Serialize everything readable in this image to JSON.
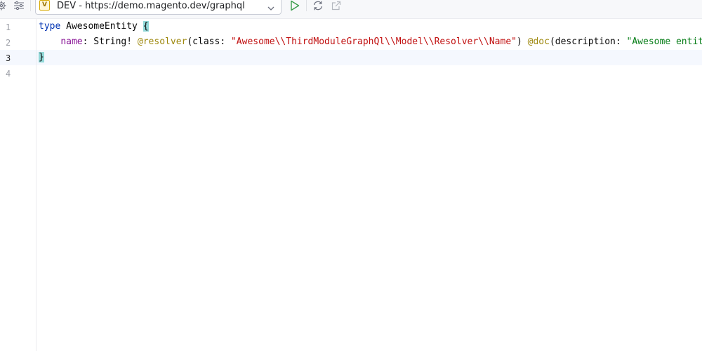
{
  "toolbar": {
    "icons": [
      "settings-gear-icon",
      "filter-sliders-icon",
      "run-play-icon",
      "refresh-icon",
      "open-external-icon"
    ],
    "environment": {
      "badge": "V",
      "selected": "DEV - https://demo.magento.dev/graphql"
    }
  },
  "colors": {
    "keyword": "#0033b3",
    "field": "#871094",
    "directive": "#9e880d",
    "string": "#c11010",
    "doc_string": "#067d17",
    "run_green": "#3b9c4c",
    "brace_highlight": "#93d9d9"
  },
  "editor": {
    "line_numbers": [
      "1",
      "2",
      "3",
      "4"
    ],
    "current_line": "3",
    "lines": {
      "l1": {
        "keyword": "type",
        "name": " AwesomeEntity ",
        "brace": "{"
      },
      "l2": {
        "indent": "    ",
        "field": "name",
        "type_part": ": String! ",
        "directive1": "@resolver",
        "args1_open": "(class: ",
        "class_value": "\"Awesome\\\\ThirdModuleGraphQl\\\\Model\\\\Resolver\\\\Name\"",
        "args1_close": ") ",
        "directive2": "@doc",
        "args2_open": "(description: ",
        "description_value": "\"Awesome entit"
      },
      "l3": {
        "brace": "}"
      }
    }
  }
}
